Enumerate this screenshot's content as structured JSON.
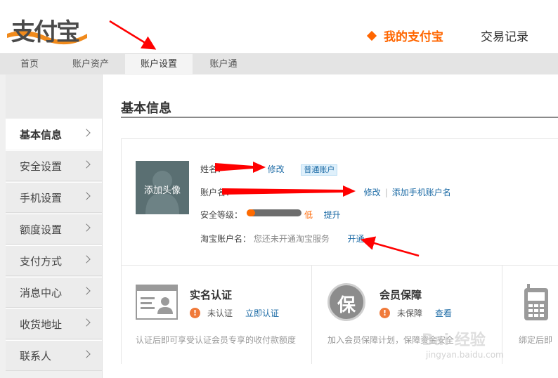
{
  "header": {
    "logo_text": "支付宝",
    "nav_mine": "我的支付宝",
    "nav_trade": "交易记录"
  },
  "subnav": {
    "items": [
      {
        "label": "首页"
      },
      {
        "label": "账户资产"
      },
      {
        "label": "账户设置"
      },
      {
        "label": "账户通"
      }
    ],
    "active": "账户设置"
  },
  "sidebar": {
    "items": [
      {
        "label": "基本信息"
      },
      {
        "label": "安全设置"
      },
      {
        "label": "手机设置"
      },
      {
        "label": "额度设置"
      },
      {
        "label": "支付方式"
      },
      {
        "label": "消息中心"
      },
      {
        "label": "收货地址"
      },
      {
        "label": "联系人"
      }
    ],
    "active": "基本信息"
  },
  "main": {
    "title": "基本信息",
    "avatar_label": "添加头像",
    "name_label": "姓名：",
    "name_edit": "修改",
    "account_type": "普通账户",
    "account_label": "账户名：",
    "account_edit": "修改",
    "account_add_phone": "添加手机账户名",
    "security_label": "安全等级：",
    "security_value": "低",
    "security_upgrade": "提升",
    "security_level": 0.15,
    "taobao_label": "淘宝账户名：",
    "taobao_status": "您还未开通淘宝服务",
    "taobao_open": "开通"
  },
  "cards": [
    {
      "title": "实名认证",
      "status": "未认证",
      "action": "立即认证",
      "desc": "认证后即可享受认证会员专享的收付款额度"
    },
    {
      "title": "会员保障",
      "status": "未保障",
      "action": "查看",
      "desc": "加入会员保障计划，保障资金安全",
      "icon_char": "保"
    },
    {
      "desc": "绑定后即"
    }
  ],
  "watermark": {
    "text": "Bai 经验",
    "sub": "jingyan.baidu.com"
  },
  "colors": {
    "accent": "#ff6600",
    "link": "#1b6aa5",
    "arrow": "#ff0000",
    "warning": "#f07a3a"
  }
}
